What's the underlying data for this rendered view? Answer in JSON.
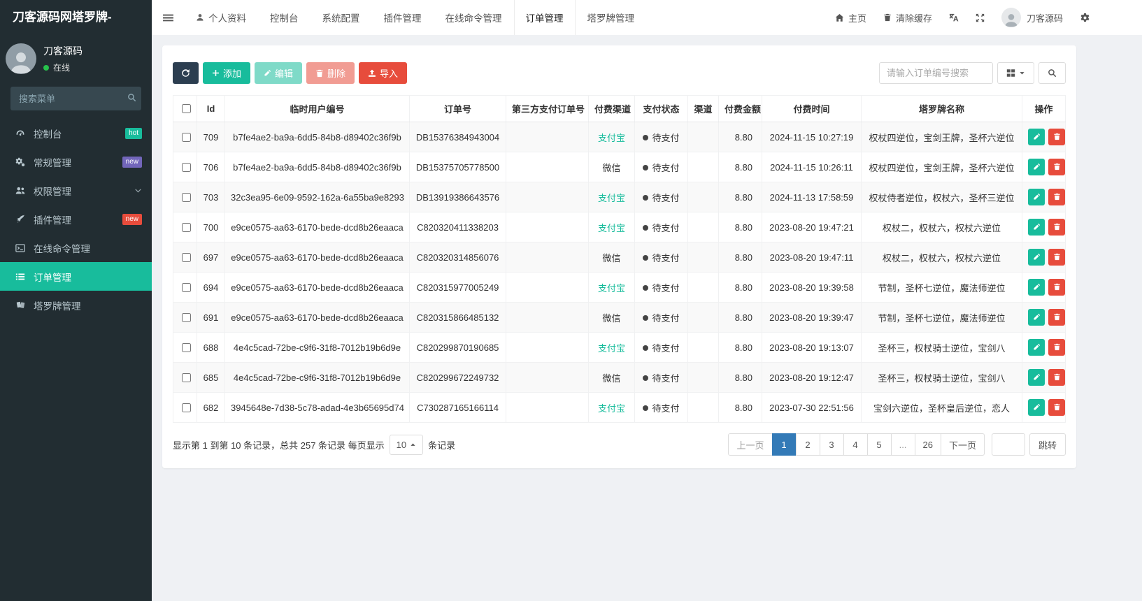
{
  "brand": "刀客源码网塔罗牌-",
  "colors": {
    "sidebar_bg": "#222d32",
    "accent_green": "#18bc9c",
    "danger_red": "#e74c3c",
    "primary_dark": "#2c3e50",
    "pagination_active_blue": "#337ab7",
    "badge_purple": "#7266ba",
    "online_green": "#27c24c"
  },
  "icons": {
    "hamburger-icon": "three-bars",
    "user-icon": "person-silhouette",
    "home-icon": "house",
    "trash-icon": "trash-can",
    "translate-icon": "language-translate",
    "fullscreen-icon": "arrows-expand",
    "gear-icon": "settings-gear",
    "search-icon": "magnifier",
    "refresh-icon": "circular-arrow",
    "plus-icon": "plus",
    "pencil-icon": "pencil",
    "upload-icon": "import-upload-arrow",
    "columns-icon": "grid-squares",
    "caret-down-icon": "triangle-down",
    "caret-up-icon": "triangle-up",
    "dashboard-icon": "gauge",
    "cogs-icon": "gears",
    "users-icon": "two-people",
    "rocket-icon": "rocket",
    "terminal-icon": "command-prompt",
    "list-icon": "list-lines",
    "cards-icon": "tarot-cards",
    "chevron-down-icon": "chevron-down",
    "status-dot": "filled-circle"
  },
  "sidebar": {
    "user": {
      "name": "刀客源码",
      "status": "在线"
    },
    "search_placeholder": "搜索菜单",
    "items": [
      {
        "key": "dashboard",
        "label": "控制台",
        "icon": "dashboard",
        "badge": "hot",
        "badge_color": "#18bc9c"
      },
      {
        "key": "general",
        "label": "常规管理",
        "icon": "cogs",
        "badge": "new",
        "badge_color": "#7266ba"
      },
      {
        "key": "auth",
        "label": "权限管理",
        "icon": "users",
        "chevron": true
      },
      {
        "key": "addon",
        "label": "插件管理",
        "icon": "rocket",
        "badge": "new",
        "badge_color": "#e74c3c"
      },
      {
        "key": "command",
        "label": "在线命令管理",
        "icon": "terminal"
      },
      {
        "key": "order",
        "label": "订单管理",
        "icon": "list",
        "active": true
      },
      {
        "key": "tarot",
        "label": "塔罗牌管理",
        "icon": "cards"
      }
    ]
  },
  "topnav": {
    "tabs": [
      {
        "key": "profile",
        "label": "个人资料",
        "icon": "user"
      },
      {
        "key": "dashboard",
        "label": "控制台"
      },
      {
        "key": "config",
        "label": "系统配置"
      },
      {
        "key": "addon",
        "label": "插件管理"
      },
      {
        "key": "command",
        "label": "在线命令管理"
      },
      {
        "key": "order",
        "label": "订单管理",
        "active": true
      },
      {
        "key": "tarot",
        "label": "塔罗牌管理"
      }
    ],
    "home_label": "主页",
    "clear_cache_label": "清除缓存",
    "user_name": "刀客源码"
  },
  "toolbar": {
    "add_label": "添加",
    "edit_label": "编辑",
    "delete_label": "删除",
    "import_label": "导入",
    "search_placeholder": "请输入订单编号搜索"
  },
  "table": {
    "highlight_channel": "支付宝",
    "highlight_color": "#18bc9c",
    "headers": [
      "Id",
      "临时用户编号",
      "订单号",
      "第三方支付订单号",
      "付费渠道",
      "支付状态",
      "渠道",
      "付费金额",
      "付费时间",
      "塔罗牌名称",
      "操作"
    ],
    "rows": [
      {
        "id": "709",
        "user_no": "b7fe4ae2-ba9a-6dd5-84b8-d89402c36f9b",
        "order_no": "DB15376384943004",
        "third_no": "",
        "pay_channel": "支付宝",
        "pay_status": "待支付",
        "channel": "",
        "amount": "8.80",
        "pay_time": "2024-11-15 10:27:19",
        "tarot": "权杖四逆位，宝剑王牌，圣杯六逆位"
      },
      {
        "id": "706",
        "user_no": "b7fe4ae2-ba9a-6dd5-84b8-d89402c36f9b",
        "order_no": "DB15375705778500",
        "third_no": "",
        "pay_channel": "微信",
        "pay_status": "待支付",
        "channel": "",
        "amount": "8.80",
        "pay_time": "2024-11-15 10:26:11",
        "tarot": "权杖四逆位，宝剑王牌，圣杯六逆位"
      },
      {
        "id": "703",
        "user_no": "32c3ea95-6e09-9592-162a-6a55ba9e8293",
        "order_no": "DB13919386643576",
        "third_no": "",
        "pay_channel": "支付宝",
        "pay_status": "待支付",
        "channel": "",
        "amount": "8.80",
        "pay_time": "2024-11-13 17:58:59",
        "tarot": "权杖侍者逆位，权杖六，圣杯三逆位"
      },
      {
        "id": "700",
        "user_no": "e9ce0575-aa63-6170-bede-dcd8b26eaaca",
        "order_no": "C820320411338203",
        "third_no": "",
        "pay_channel": "支付宝",
        "pay_status": "待支付",
        "channel": "",
        "amount": "8.80",
        "pay_time": "2023-08-20 19:47:21",
        "tarot": "权杖二，权杖六，权杖六逆位"
      },
      {
        "id": "697",
        "user_no": "e9ce0575-aa63-6170-bede-dcd8b26eaaca",
        "order_no": "C820320314856076",
        "third_no": "",
        "pay_channel": "微信",
        "pay_status": "待支付",
        "channel": "",
        "amount": "8.80",
        "pay_time": "2023-08-20 19:47:11",
        "tarot": "权杖二，权杖六，权杖六逆位"
      },
      {
        "id": "694",
        "user_no": "e9ce0575-aa63-6170-bede-dcd8b26eaaca",
        "order_no": "C820315977005249",
        "third_no": "",
        "pay_channel": "支付宝",
        "pay_status": "待支付",
        "channel": "",
        "amount": "8.80",
        "pay_time": "2023-08-20 19:39:58",
        "tarot": "节制，圣杯七逆位，魔法师逆位"
      },
      {
        "id": "691",
        "user_no": "e9ce0575-aa63-6170-bede-dcd8b26eaaca",
        "order_no": "C820315866485132",
        "third_no": "",
        "pay_channel": "微信",
        "pay_status": "待支付",
        "channel": "",
        "amount": "8.80",
        "pay_time": "2023-08-20 19:39:47",
        "tarot": "节制，圣杯七逆位，魔法师逆位"
      },
      {
        "id": "688",
        "user_no": "4e4c5cad-72be-c9f6-31f8-7012b19b6d9e",
        "order_no": "C820299870190685",
        "third_no": "",
        "pay_channel": "支付宝",
        "pay_status": "待支付",
        "channel": "",
        "amount": "8.80",
        "pay_time": "2023-08-20 19:13:07",
        "tarot": "圣杯三，权杖骑士逆位，宝剑八"
      },
      {
        "id": "685",
        "user_no": "4e4c5cad-72be-c9f6-31f8-7012b19b6d9e",
        "order_no": "C820299672249732",
        "third_no": "",
        "pay_channel": "微信",
        "pay_status": "待支付",
        "channel": "",
        "amount": "8.80",
        "pay_time": "2023-08-20 19:12:47",
        "tarot": "圣杯三，权杖骑士逆位，宝剑八"
      },
      {
        "id": "682",
        "user_no": "3945648e-7d38-5c78-adad-4e3b65695d74",
        "order_no": "C730287165166114",
        "third_no": "",
        "pay_channel": "支付宝",
        "pay_status": "待支付",
        "channel": "",
        "amount": "8.80",
        "pay_time": "2023-07-30 22:51:56",
        "tarot": "宝剑六逆位，圣杯皇后逆位，恋人"
      }
    ]
  },
  "footer": {
    "summary_before": "显示第 1 到第 10 条记录，总共 257 条记录 每页显示",
    "page_size": "10",
    "summary_after": "条记录",
    "pagination": {
      "prev": "上一页",
      "pages": [
        "1",
        "2",
        "3",
        "4",
        "5",
        "...",
        "26"
      ],
      "active": "1",
      "next": "下一页"
    },
    "jump_label": "跳转"
  }
}
